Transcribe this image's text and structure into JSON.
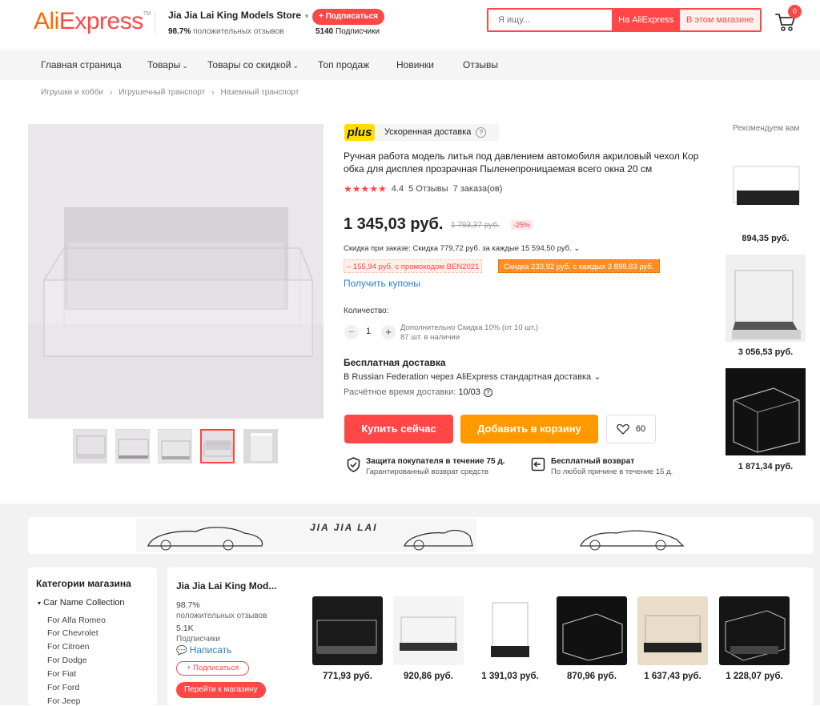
{
  "header": {
    "logo_part1": "Ali",
    "logo_part2": "Express",
    "logo_tm": "TM",
    "store_name": "Jia Jia Lai King Models Store",
    "store_rating_pct": "98.7%",
    "store_rating_label": "положительных отзывов",
    "subscribe_label": "+ Подписаться",
    "subscribers_count": "5140",
    "subscribers_label": "Подписчики",
    "search_placeholder": "Я ищу...",
    "search_btn_all": "На AliExpress",
    "search_btn_store": "В этом магазине",
    "cart_count": "0"
  },
  "nav": {
    "items": [
      {
        "label": "Главная страница",
        "dropdown": false
      },
      {
        "label": "Товары",
        "dropdown": true
      },
      {
        "label": "Товары со скидкой",
        "dropdown": true
      },
      {
        "label": "Топ продаж",
        "dropdown": false
      },
      {
        "label": "Новинки",
        "dropdown": false
      },
      {
        "label": "Отзывы",
        "dropdown": false
      }
    ]
  },
  "breadcrumb": [
    "Игрушки и хобби",
    "Игрушечный транспорт",
    "Наземный транспорт"
  ],
  "product": {
    "plus_badge": "plus",
    "plus_text": "Ускоренная доставка",
    "title": "Ручная работа модель литья под давлением автомобиля акриловый чехол Кор обка для дисплея прозрачная Пыленепроницаемая всего окна 20 см",
    "stars": "★★★★★",
    "rating": "4.4",
    "reviews": "5 Отзывы",
    "orders": "7 заказа(ов)",
    "price": "1 345,03 руб.",
    "old_price": "1 793,37 руб.",
    "discount": "-25%",
    "order_discount": "Скидка при заказе: Скидка 779,72 руб. за каждые 15 594,50 руб. ⌄",
    "promo_code": "– 155,94 руб. с промокодом BEN2021",
    "promo_store": "Скидка 233,92 руб. с каждых 3 898,63 руб.",
    "coupons_link": "Получить купоны",
    "quantity_label": "Количество:",
    "quantity_value": "1",
    "quantity_info1": "Дополнительно Скидка 10% (от 10 шт.)",
    "quantity_info2": "87 шт. в наличии",
    "shipping_title": "Бесплатная доставка",
    "shipping_desc": "В Russian Federation через AliExpress стандартная доставка ⌄",
    "delivery_label": "Расчётное время доставки:",
    "delivery_date": "10/03",
    "buy_now": "Купить сейчас",
    "add_to_cart": "Добавить в корзину",
    "wishlist_count": "60",
    "protection_title": "Защита покупателя в течение 75 д.",
    "protection_desc": "Гарантированный возврат средств",
    "return_title": "Бесплатный возврат",
    "return_desc": "По любой причине в течение 15 д."
  },
  "recommend": {
    "title": "Рекомендуем вам",
    "items": [
      {
        "price": "894,35 руб."
      },
      {
        "price": "3 056,53 руб."
      },
      {
        "price": "1 871,34 руб."
      }
    ]
  },
  "banner_text": "JIA JIA LAI",
  "categories": {
    "title": "Категории магазина",
    "group": "Car Name Collection",
    "items": [
      "For Alfa Romeo",
      "For Chevrolet",
      "For Citroen",
      "For Dodge",
      "For Fiat",
      "For Ford",
      "For Jeep"
    ]
  },
  "store_panel": {
    "name": "Jia Jia Lai King Mod...",
    "rating": "98.7%",
    "rating_label": "положительных отзывов",
    "subs": "5.1K",
    "subs_label": "Подписчики",
    "message": "Написать",
    "subscribe": "+ Подписаться",
    "goto_store": "Перейти к магазину",
    "products": [
      {
        "price": "771,93 руб."
      },
      {
        "price": "920,86 руб."
      },
      {
        "price": "1 391,03 руб."
      },
      {
        "price": "870,96 руб."
      },
      {
        "price": "1 637,43 руб."
      },
      {
        "price": "1 228,07 руб."
      }
    ]
  },
  "colors": {
    "accent_red": "#ff4747",
    "accent_orange": "#ff9900",
    "plus_yellow": "#ffdf00",
    "link_blue": "#2f80c0"
  }
}
